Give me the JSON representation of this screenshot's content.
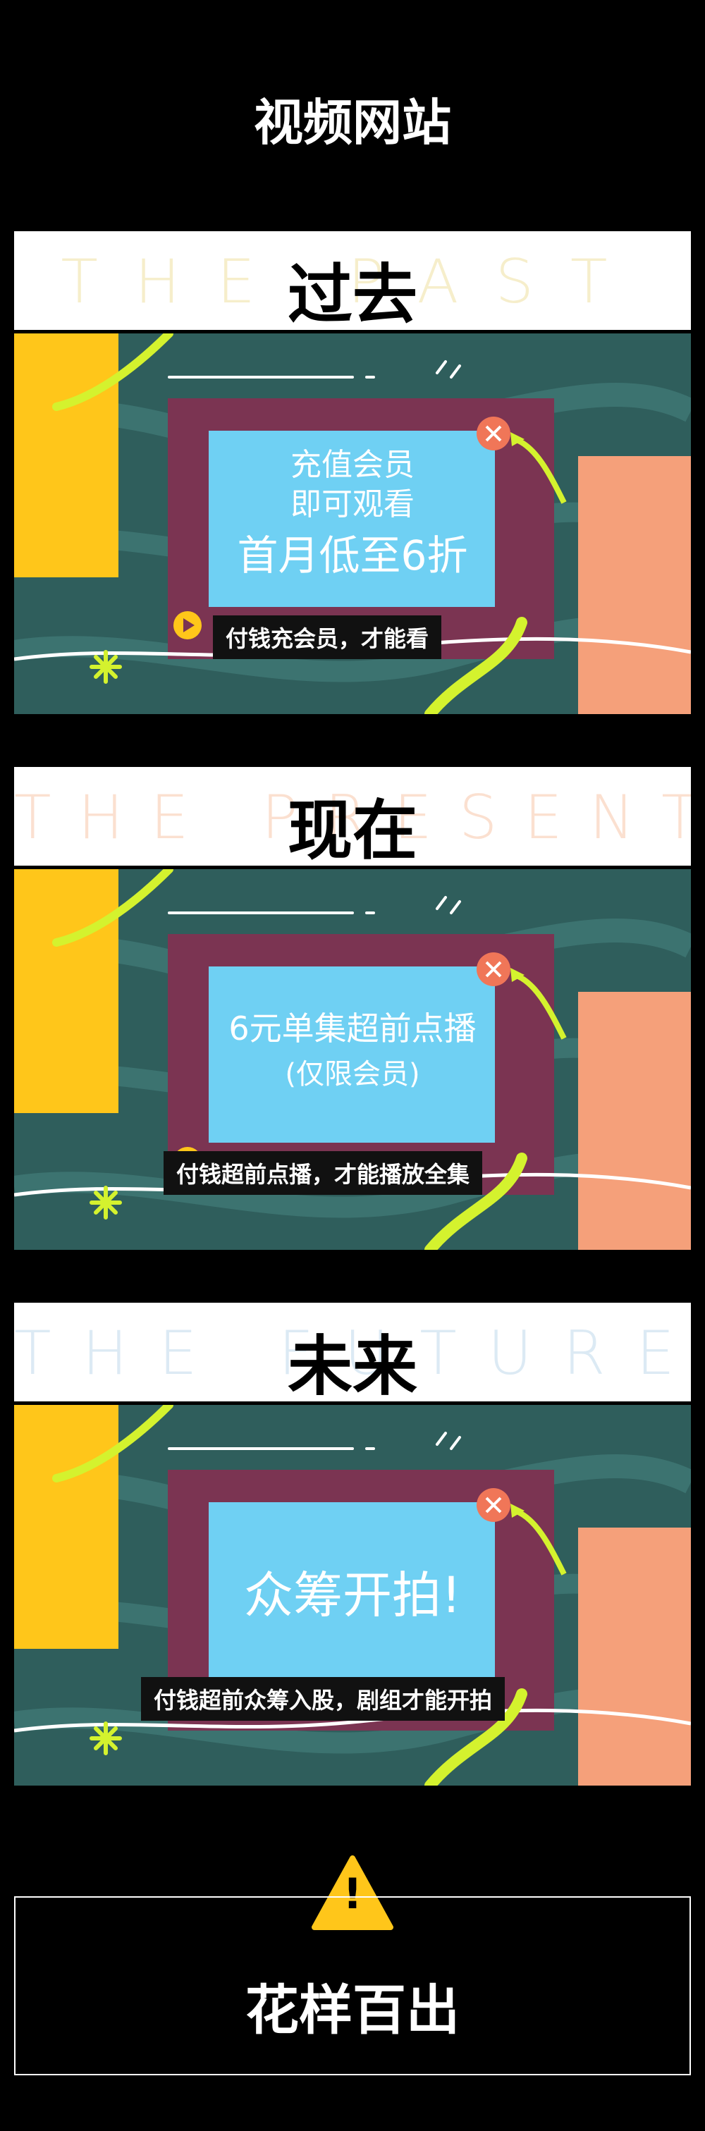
{
  "page_title": "视频网站",
  "sections": [
    {
      "ghost": "THE PAST",
      "heading": "过去",
      "screen_lines": [
        "充值会员",
        "即可观看",
        "首月低至6折"
      ],
      "caption": "付钱充会员，才能看"
    },
    {
      "ghost": "THE PRESENT",
      "heading": "现在",
      "screen_lines": [
        "6元单集超前点播",
        "(仅限会员)"
      ],
      "caption": "付钱超前点播，才能播放全集"
    },
    {
      "ghost": "THE FUTURE",
      "heading": "未来",
      "screen_lines": [
        "众筹开拍!"
      ],
      "caption": "付钱超前众筹入股，剧组才能开拍"
    }
  ],
  "warning_symbol": "!",
  "ending_title": "花样百出",
  "colors": {
    "background": "#000000",
    "scene_bg": "#2f5e5c",
    "frame": "#7b3452",
    "screen": "#6fd0f3",
    "yellow": "#ffc61a",
    "salmon": "#f5a07a",
    "lime": "#d4f22e",
    "close_button": "#f07658"
  },
  "icons": [
    "play-icon",
    "close-icon",
    "warning-icon",
    "star-doodle-icon"
  ]
}
